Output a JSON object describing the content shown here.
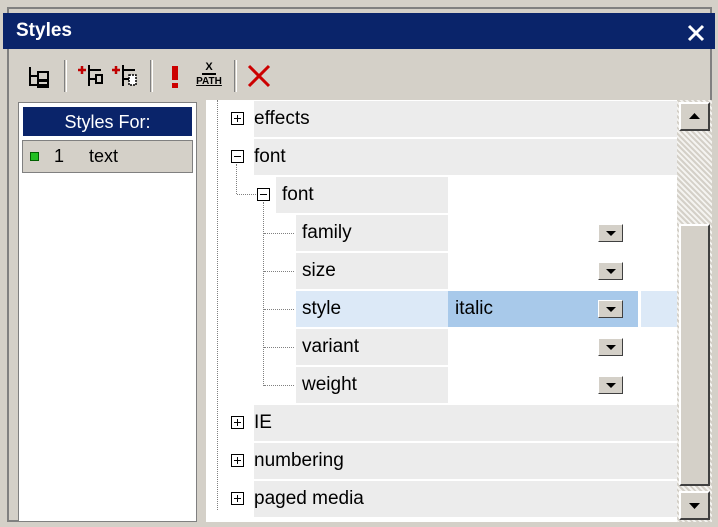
{
  "window": {
    "title": "Styles"
  },
  "toolbar": {
    "icons": [
      "tree-layout-icon",
      "add-after-icon",
      "add-before-icon",
      "important-icon",
      "xpath-icon",
      "delete-icon"
    ],
    "xpath_top": "X",
    "xpath_bottom": "PATH"
  },
  "styles_for": {
    "header": "Styles For:",
    "items": [
      {
        "index": "1",
        "label": "text"
      }
    ]
  },
  "properties": {
    "effects": "effects",
    "font_group": "font",
    "font_sub": "font",
    "family": "family",
    "size": "size",
    "style": "style",
    "style_value": "italic",
    "variant": "variant",
    "weight": "weight",
    "ie": "IE",
    "numbering": "numbering",
    "paged_media": "paged media"
  },
  "colors": {
    "titlebar": "#0a246a",
    "selection": "#a8c9ea",
    "important": "#cc0000"
  }
}
